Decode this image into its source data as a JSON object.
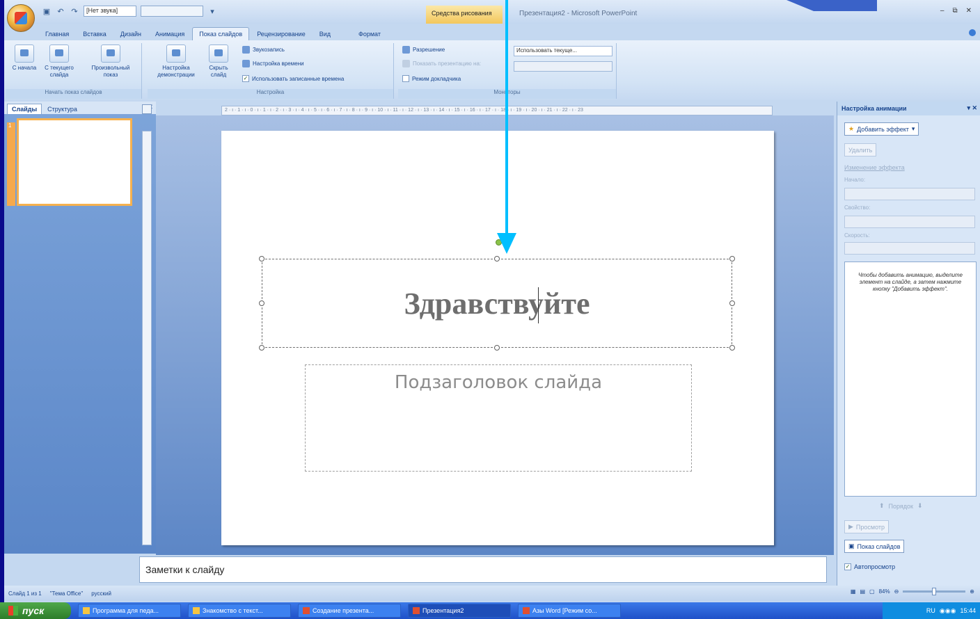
{
  "qat": {
    "sound_combo": "[Нет звука]"
  },
  "context_tab": "Средства рисования",
  "window_title": "Презентация2 - Microsoft PowerPoint",
  "window_controls": [
    "–",
    "⧉",
    "✕"
  ],
  "tabs": [
    "Главная",
    "Вставка",
    "Дизайн",
    "Анимация",
    "Показ слайдов",
    "Рецензирование",
    "Вид",
    "Формат"
  ],
  "ribbon": {
    "start_group": {
      "label": "Начать показ слайдов",
      "from_start": "С начала",
      "from_current": "С текущего слайда",
      "custom": "Произвольный показ"
    },
    "setup_group": {
      "label": "Настройка",
      "setup_show": "Настройка демонстрации",
      "hide_slide": "Скрыть слайд",
      "record": "Звукозапись",
      "rehearse": "Настройка времени",
      "use_timings": "Использовать записанные времена"
    },
    "monitors_group": {
      "label": "Мониторы",
      "resolution": "Разрешение",
      "show_on": "Показать презентацию на:",
      "presenter": "Режим докладчика",
      "resolution_value": "Использовать текуще..."
    }
  },
  "left_pane": {
    "tab_slides": "Слайды",
    "tab_outline": "Структура",
    "close": "✕",
    "slide_number": "1"
  },
  "ruler": {
    "h": "2 · ı · 1 · ı · 0 · ı · 1 · ı · 2 · ı · 3 · ı · 4 · ı · 5 · ı · 6 · ı · 7 · ı · 8 · ı · 9 · ı · 10 · ı · 11 · ı · 12 · ı · 13 · ı · 14 · ı · 15 · ı · 16 · ı · 17 · ı · 18 · ı · 19 · ı · 20 · ı · 21 · ı · 22 · ı · 23"
  },
  "slide": {
    "title": "Здравствуйте",
    "subtitle": "Подзаголовок слайда"
  },
  "notes": "Заметки к слайду",
  "animation_pane": {
    "title": "Настройка анимации",
    "add_effect": "Добавить эффект",
    "remove": "Удалить",
    "change_effect": "Изменение эффекта",
    "start": "Начало:",
    "property": "Свойство:",
    "speed": "Скорость:",
    "hint": "Чтобы добавить анимацию, выделите элемент на слайде, а затем нажмите кнопку \"Добавить эффект\".",
    "order": "Порядок",
    "preview": "Просмотр",
    "slideshow": "Показ слайдов",
    "autopreview": "Автопросмотр"
  },
  "status": {
    "slide_info": "Слайд 1 из 1",
    "theme": "\"Тема Office\"",
    "language": "русский",
    "zoom": "84%"
  },
  "taskbar": {
    "start": "пуск",
    "items": [
      "Программа для педа...",
      "Знакомство с текст...",
      "Создание презента...",
      "Презентация2",
      "Азы Word [Режим со..."
    ],
    "tray_lang": "RU",
    "clock": "15:44"
  }
}
